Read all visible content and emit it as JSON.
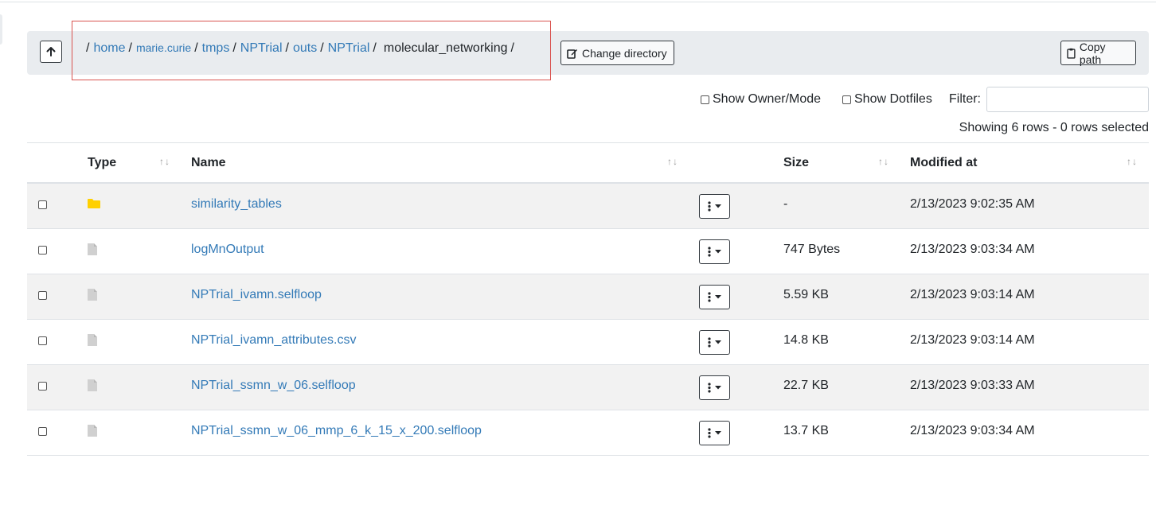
{
  "breadcrumb": {
    "root_sep": "/",
    "items": [
      {
        "label": "home",
        "sep": "/"
      },
      {
        "label": "marie.curie",
        "sep": "/"
      },
      {
        "label": "tmps",
        "sep": "/"
      },
      {
        "label": "NPTrial",
        "sep": "/"
      },
      {
        "label": "outs",
        "sep": "/"
      },
      {
        "label": "NPTrial",
        "sep": "/"
      }
    ],
    "current": "molecular_networking",
    "current_sep": "/"
  },
  "toolbar": {
    "change_directory_label": "Change directory",
    "copy_path_label": "Copy path"
  },
  "options": {
    "show_owner_mode": "Show Owner/Mode",
    "show_dotfiles": "Show Dotfiles",
    "filter_label": "Filter:",
    "filter_value": ""
  },
  "status": {
    "rows_info": "Showing 6 rows - 0 rows selected"
  },
  "table": {
    "headers": {
      "type": "Type",
      "name": "Name",
      "size": "Size",
      "modified": "Modified at"
    },
    "sort_glyph": "↑↓",
    "rows": [
      {
        "icon": "folder-icon",
        "name": "similarity_tables",
        "size": "-",
        "modified": "2/13/2023 9:02:35 AM"
      },
      {
        "icon": "file-icon",
        "name": "logMnOutput",
        "size": "747 Bytes",
        "modified": "2/13/2023 9:03:34 AM"
      },
      {
        "icon": "file-icon",
        "name": "NPTrial_ivamn.selfloop",
        "size": "5.59 KB",
        "modified": "2/13/2023 9:03:14 AM"
      },
      {
        "icon": "file-icon",
        "name": "NPTrial_ivamn_attributes.csv",
        "size": "14.8 KB",
        "modified": "2/13/2023 9:03:14 AM"
      },
      {
        "icon": "file-icon",
        "name": "NPTrial_ssmn_w_06.selfloop",
        "size": "22.7 KB",
        "modified": "2/13/2023 9:03:33 AM"
      },
      {
        "icon": "file-icon",
        "name": "NPTrial_ssmn_w_06_mmp_6_k_15_x_200.selfloop",
        "size": "13.7 KB",
        "modified": "2/13/2023 9:03:34 AM"
      }
    ]
  },
  "colors": {
    "link": "#337ab7",
    "folder": "#ffd000",
    "file": "#d0d0d0",
    "highlight": "#d9534f",
    "bar": "#e9ecef"
  }
}
